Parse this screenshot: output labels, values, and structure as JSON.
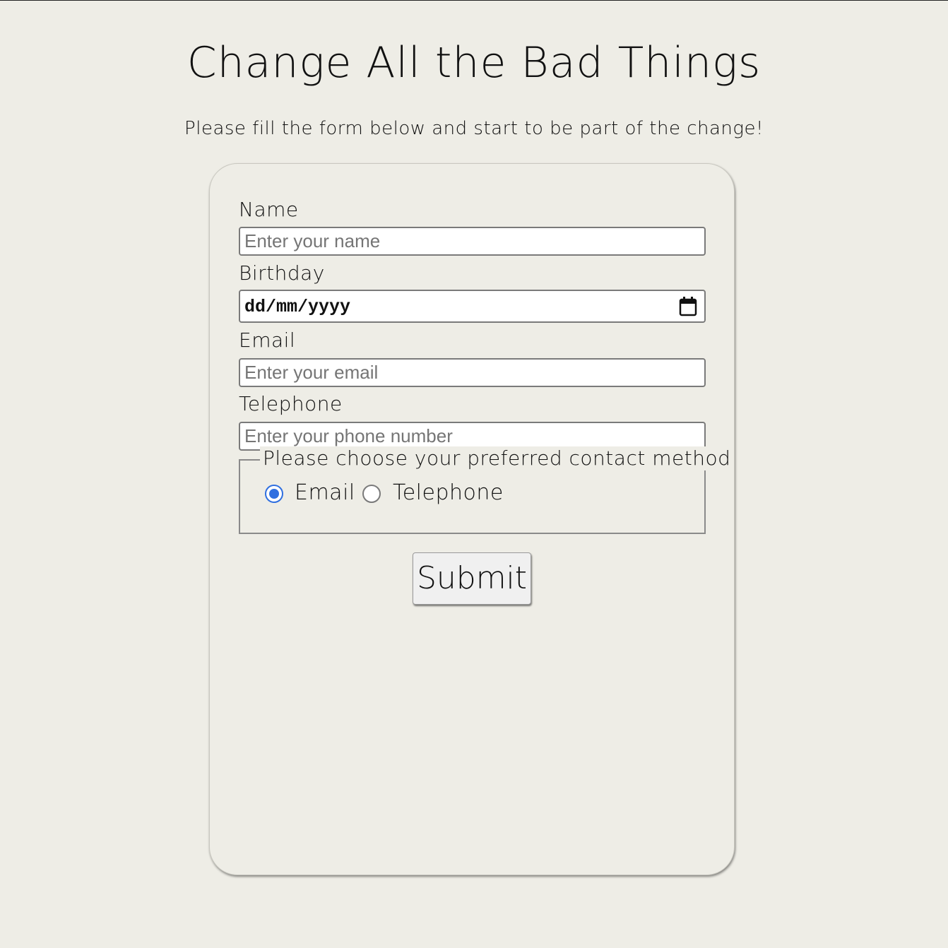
{
  "header": {
    "title": "Change All the Bad Things",
    "subtitle": "Please fill the form below and start to be part of the change!"
  },
  "form": {
    "name": {
      "label": "Name",
      "placeholder": "Enter your name",
      "value": ""
    },
    "birthday": {
      "label": "Birthday",
      "placeholder": "dd/mm/yyyy",
      "icon": "calendar-icon"
    },
    "email": {
      "label": "Email",
      "placeholder": "Enter your email",
      "value": ""
    },
    "telephone": {
      "label": "Telephone",
      "placeholder": "Enter your phone number",
      "value": ""
    },
    "contact_method": {
      "legend": "Please choose your preferred contact method",
      "options": [
        {
          "label": "Email",
          "selected": true
        },
        {
          "label": "Telephone",
          "selected": false
        }
      ]
    },
    "submit_label": "Submit"
  },
  "colors": {
    "background": "#eeede6",
    "radio_accent": "#2f6fe0",
    "text": "#111111"
  }
}
